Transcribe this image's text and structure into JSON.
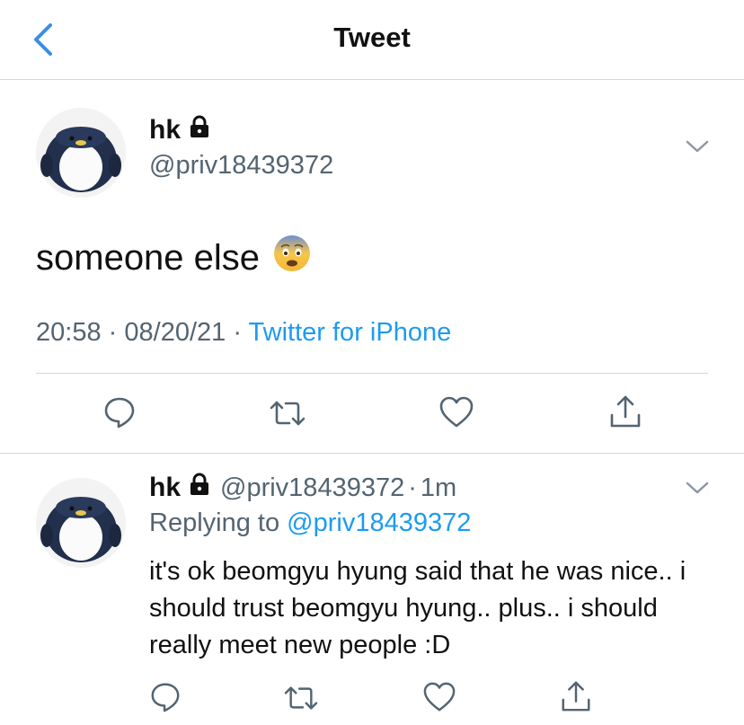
{
  "header": {
    "title": "Tweet",
    "back_icon": "chevron-left-icon"
  },
  "tweet": {
    "display_name": "hk",
    "handle": "@priv18439372",
    "text": "someone else",
    "emoji": "😨",
    "time": "20:58",
    "separator": "·",
    "date": "08/20/21",
    "source": "Twitter for iPhone"
  },
  "reply": {
    "display_name": "hk",
    "handle": "@priv18439372",
    "separator": "·",
    "age": "1m",
    "replying_prefix": "Replying to",
    "replying_to": "@priv18439372",
    "text": "it's ok beomgyu hyung said that he was nice.. i should trust beomgyu hyung.. plus.. i should really meet new people :D"
  },
  "colors": {
    "link": "#1d9bf0",
    "secondary": "#536471",
    "divider": "#d5d8db",
    "icon": "#536471",
    "back": "#1d9bf0"
  }
}
